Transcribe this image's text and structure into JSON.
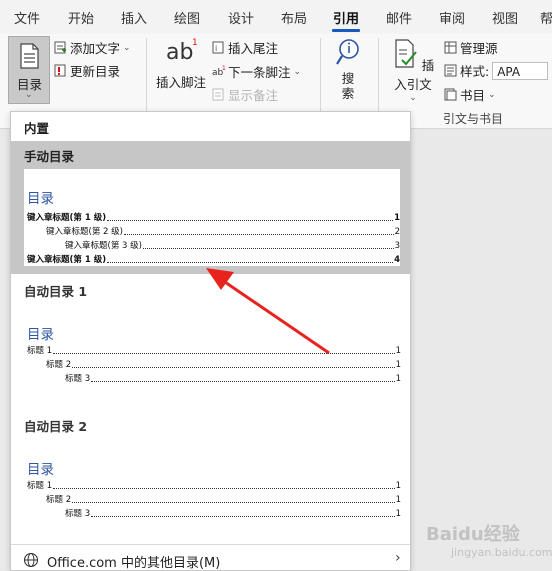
{
  "tabs": [
    "文件",
    "开始",
    "插入",
    "绘图",
    "设计",
    "布局",
    "引用",
    "邮件",
    "审阅",
    "视图",
    "帮"
  ],
  "active_tab": "引用",
  "ribbon": {
    "toc_label": "目录",
    "add_text": "添加文字",
    "update_toc": "更新目录",
    "insert_footnote": "插入脚注",
    "footnote_glyph": "ab",
    "footnote_sup": "1",
    "insert_endnote": "插入尾注",
    "next_footnote": "下一条脚注",
    "show_notes": "显示备注",
    "search": "搜索",
    "insert_citation": "插入引文",
    "manage_sources": "管理源",
    "style_label": "样式:",
    "style_value": "APA",
    "bibliography": "书目",
    "group_citations": "引文与书目"
  },
  "panel": {
    "builtin": "内置",
    "manual_title": "手动目录",
    "auto1_title": "自动目录 1",
    "auto2_title": "自动目录 2",
    "toc_heading": "目录",
    "manual_lines": [
      {
        "text": "键入章标题(第 1 级)",
        "page": "1"
      },
      {
        "text": "键入章标题(第 2 级)",
        "page": "2"
      },
      {
        "text": "键入章标题(第 3 级)",
        "page": "3"
      },
      {
        "text": "键入章标题(第 1 级)",
        "page": "4"
      }
    ],
    "auto_lines": [
      {
        "text": "标题 1",
        "page": "1"
      },
      {
        "text": "标题 2",
        "page": "1"
      },
      {
        "text": "标题 3",
        "page": "1"
      }
    ],
    "more_toc": "Office.com 中的其他目录(M)"
  },
  "watermark": "Baidu经验",
  "watermark_sub": "jingyan.baidu.com",
  "colors": {
    "accent": "#185abd",
    "arrow": "#e8231e",
    "toc_title": "#2e56a3"
  }
}
